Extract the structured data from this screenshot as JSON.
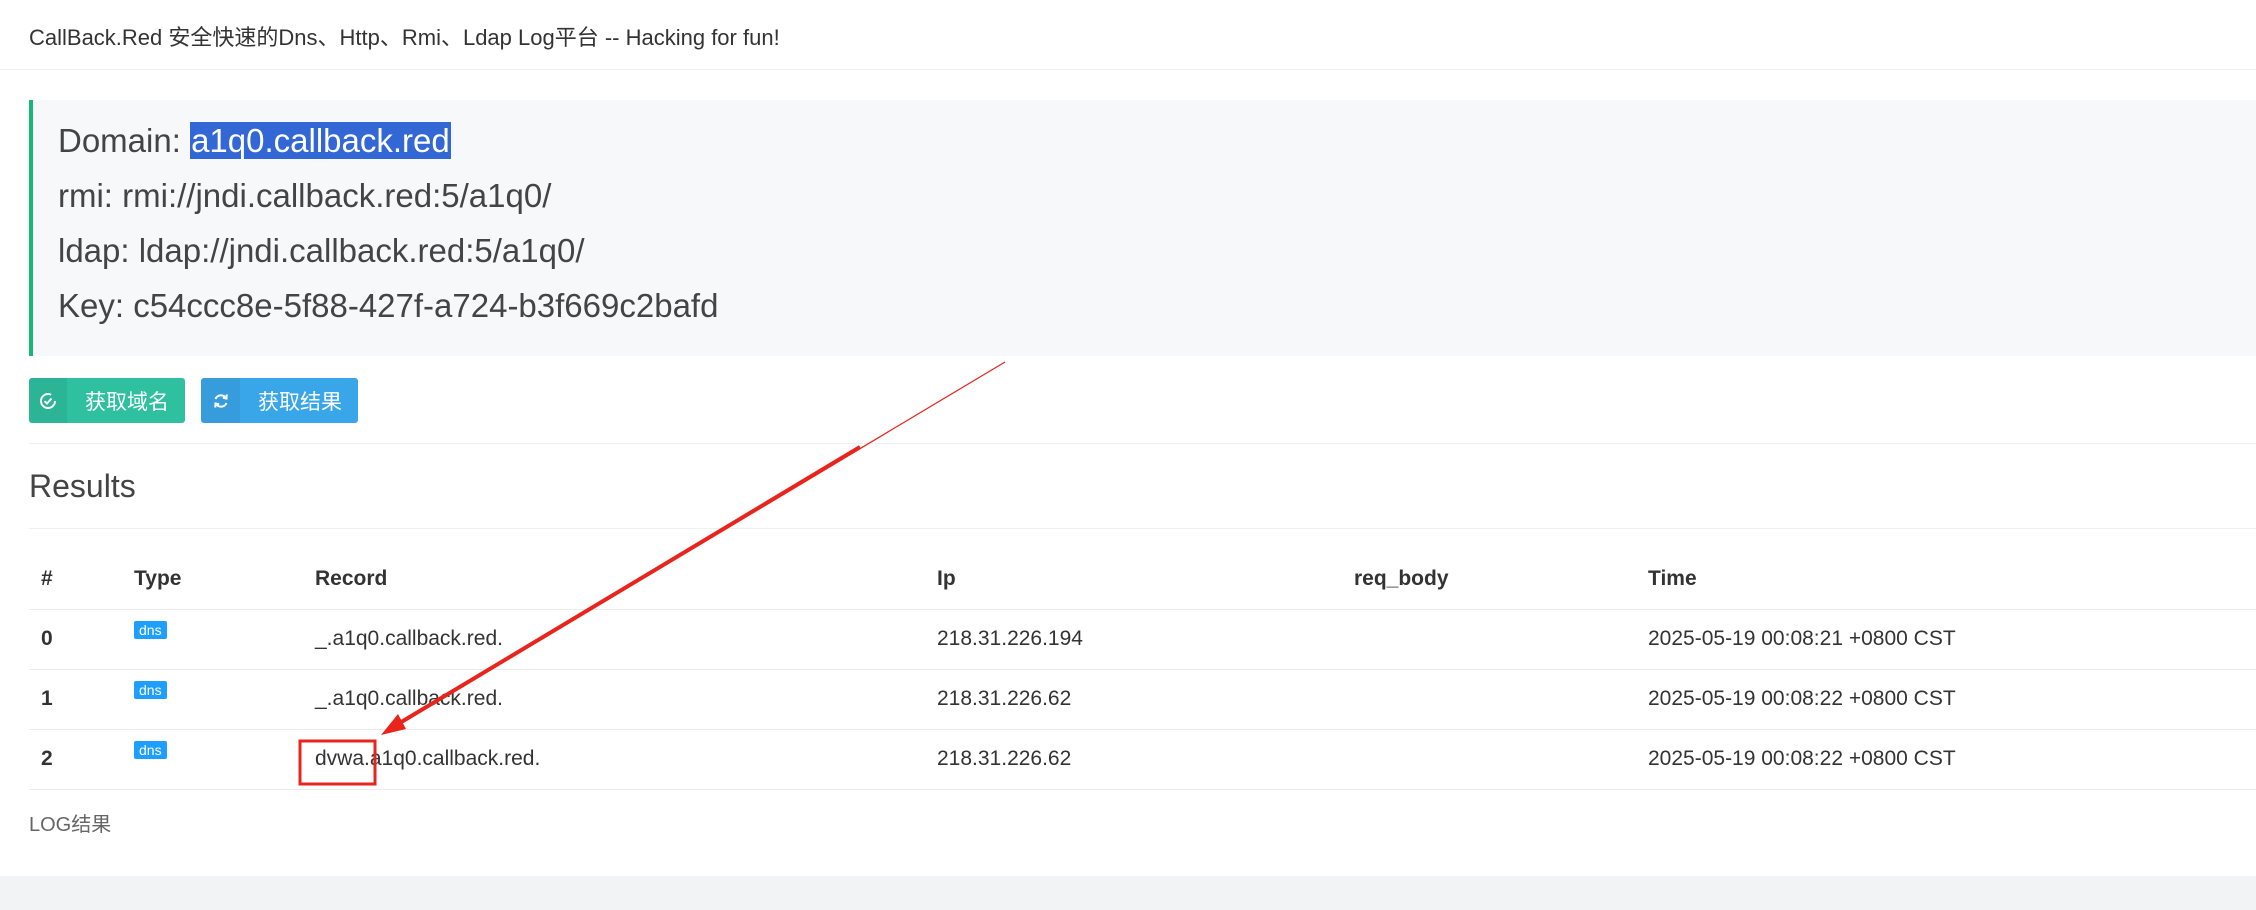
{
  "header": {
    "title": "CallBack.Red 安全快速的Dns、Http、Rmi、Ldap Log平台 -- Hacking for fun!"
  },
  "info": {
    "domain_label": "Domain: ",
    "domain_value": "a1q0.callback.red",
    "rmi_line": "rmi: rmi://jndi.callback.red:5/a1q0/",
    "ldap_line": "ldap: ldap://jndi.callback.red:5/a1q0/",
    "key_line": "Key: c54ccc8e-5f88-427f-a724-b3f669c2bafd"
  },
  "buttons": {
    "get_domain": "获取域名",
    "get_results": "获取结果",
    "get_domain_icon": "check-circle-icon",
    "get_results_icon": "refresh-icon"
  },
  "results": {
    "title": "Results",
    "columns": [
      "#",
      "Type",
      "Record",
      "Ip",
      "req_body",
      "Time"
    ],
    "rows": [
      {
        "num": "0",
        "type": "dns",
        "record": "_.a1q0.callback.red.",
        "ip": "218.31.226.194",
        "req_body": "",
        "time": "2025-05-19 00:08:21 +0800 CST"
      },
      {
        "num": "1",
        "type": "dns",
        "record": "_.a1q0.callback.red.",
        "ip": "218.31.226.62",
        "req_body": "",
        "time": "2025-05-19 00:08:22 +0800 CST"
      },
      {
        "num": "2",
        "type": "dns",
        "record": "dvwa.a1q0.callback.red.",
        "ip": "218.31.226.62",
        "req_body": "",
        "time": "2025-05-19 00:08:22 +0800 CST"
      }
    ]
  },
  "footer": {
    "text": "LOG结果"
  },
  "colors": {
    "accent_green": "#16b777",
    "button_green": "#2fc0a0",
    "button_blue": "#3aa6ea",
    "badge_blue": "#1e9fff",
    "selection": "#3367d6",
    "annotation_red": "#e8241c"
  }
}
